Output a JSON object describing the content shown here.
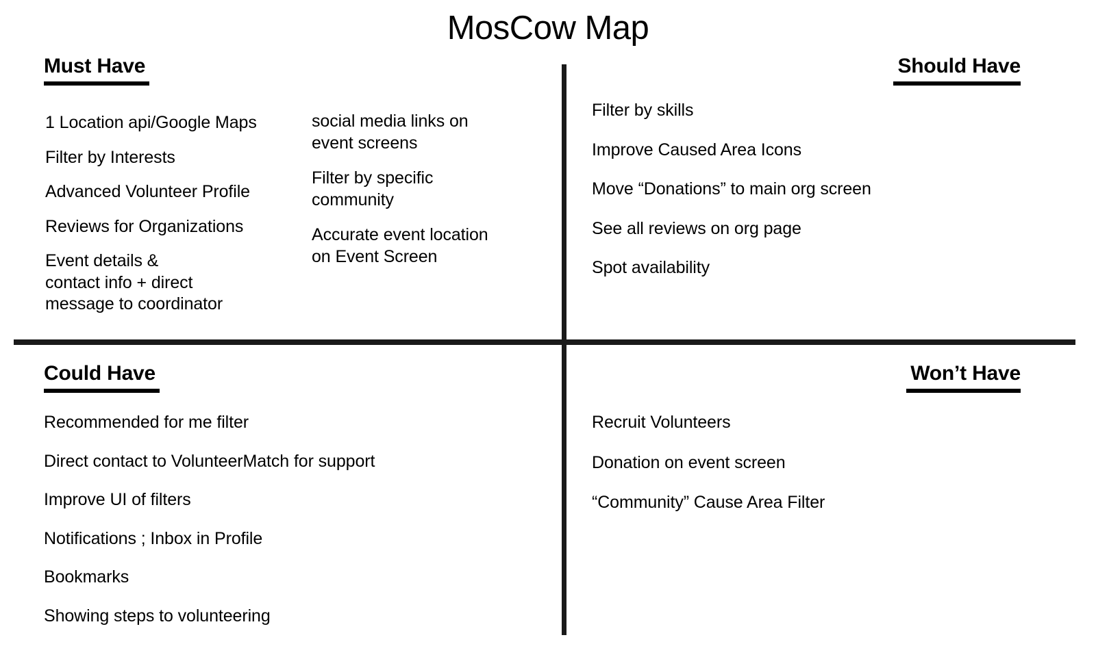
{
  "title": "MosCow Map",
  "colors": {
    "ink": "#000000",
    "divider": "#1a1a1a",
    "background": "#ffffff"
  },
  "quadrants": {
    "must_have": {
      "heading": "Must Have",
      "column_a": [
        "1 Location api/Google Maps",
        "Filter by Interests",
        "Advanced Volunteer Profile",
        "Reviews for Organizations",
        "Event details &\ncontact info + direct\nmessage to coordinator"
      ],
      "column_b": [
        "social media links on\nevent screens",
        "Filter by specific\ncommunity",
        "Accurate event location\non Event Screen"
      ]
    },
    "should_have": {
      "heading": "Should Have",
      "items": [
        "Filter by skills",
        "Improve Caused Area Icons",
        "Move “Donations” to main org screen",
        "See all reviews on org page",
        "Spot availability"
      ]
    },
    "could_have": {
      "heading": "Could Have",
      "items": [
        "Recommended for me filter",
        "Direct contact to VolunteerMatch for support",
        "Improve UI of filters",
        "Notifications ; Inbox in Profile",
        "Bookmarks",
        "Showing steps to volunteering"
      ]
    },
    "wont_have": {
      "heading": "Won’t Have",
      "items": [
        "Recruit Volunteers",
        "Donation on event screen",
        "“Community” Cause Area Filter"
      ]
    }
  }
}
